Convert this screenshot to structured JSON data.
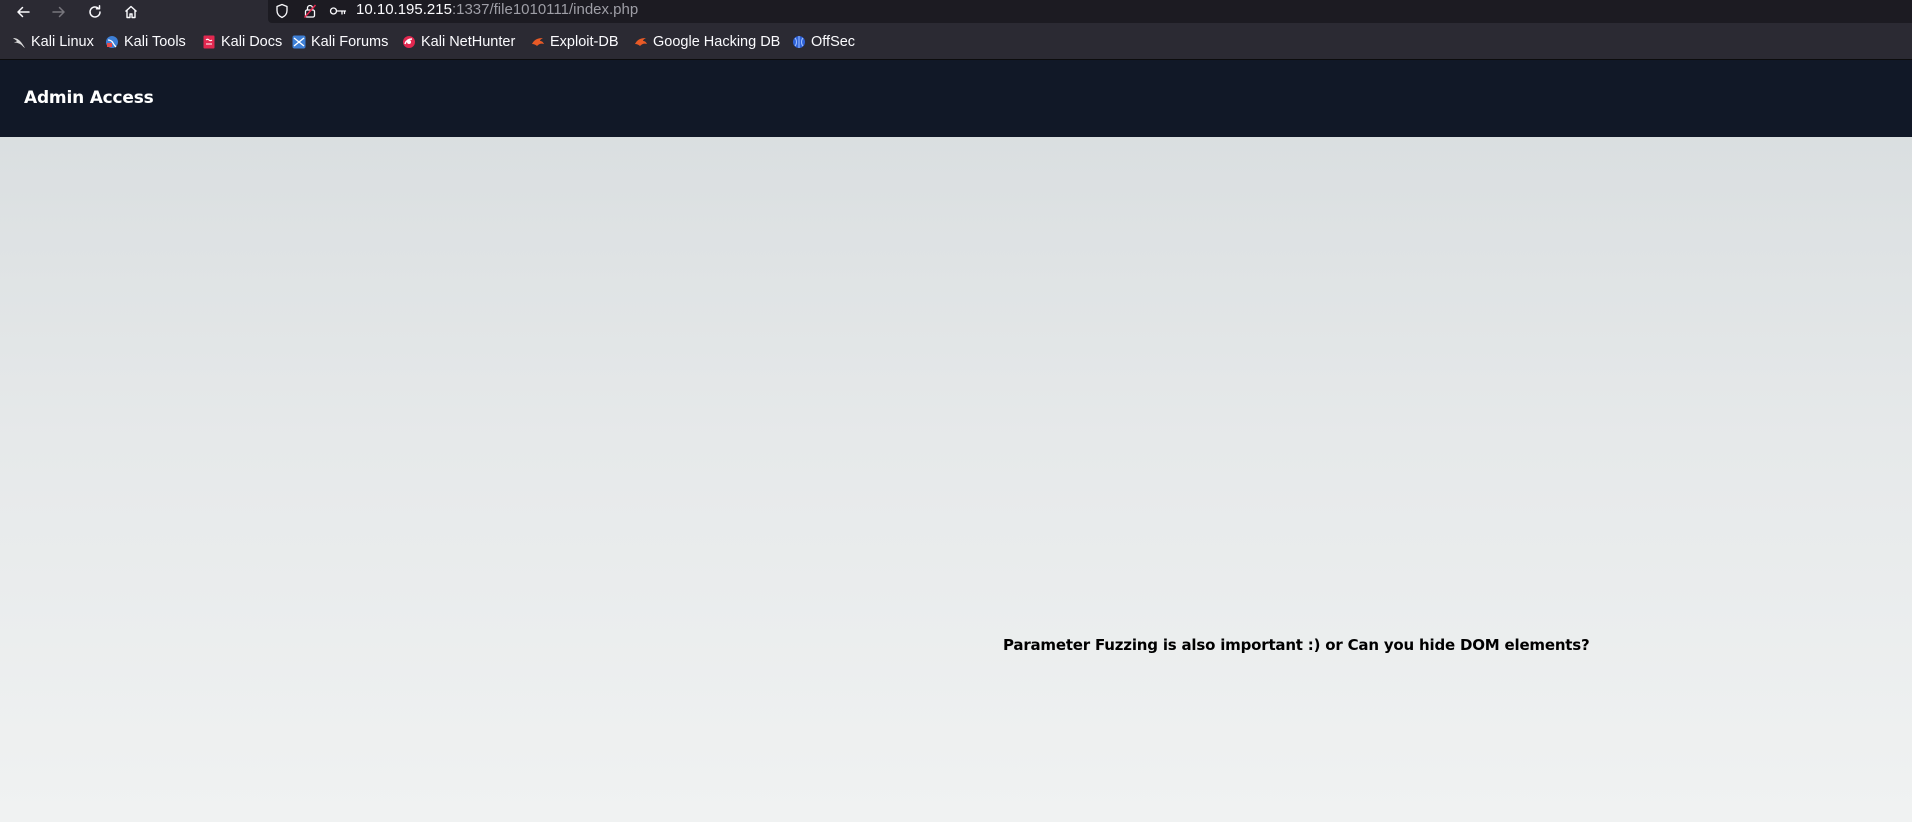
{
  "browser": {
    "url": {
      "host": "10.10.195.215",
      "path": ":1337/file1010111/index.php"
    },
    "icons": {
      "back": "arrow-left-icon",
      "forward": "arrow-right-icon",
      "reload": "reload-icon",
      "home": "home-icon",
      "tracking": "shield-icon",
      "lock": "lock-icon",
      "key": "key-icon"
    },
    "bookmarks": [
      {
        "label": "Kali Linux",
        "icon": "kali-dragon-icon"
      },
      {
        "label": "Kali Tools",
        "icon": "kali-tools-icon"
      },
      {
        "label": "Kali Docs",
        "icon": "kali-docs-icon"
      },
      {
        "label": "Kali Forums",
        "icon": "kali-forums-icon"
      },
      {
        "label": "Kali NetHunter",
        "icon": "kali-nethunter-icon"
      },
      {
        "label": "Exploit-DB",
        "icon": "exploit-db-icon"
      },
      {
        "label": "Google Hacking DB",
        "icon": "ghdb-icon"
      },
      {
        "label": "OffSec",
        "icon": "offsec-icon"
      }
    ]
  },
  "page": {
    "header_title": "Admin Access",
    "message": "Parameter Fuzzing is also important :) or Can you hide DOM elements?"
  },
  "colors": {
    "header_bg": "#111827",
    "toolbar_bg": "#2b2a33",
    "urlbar_bg": "#1c1b22"
  }
}
